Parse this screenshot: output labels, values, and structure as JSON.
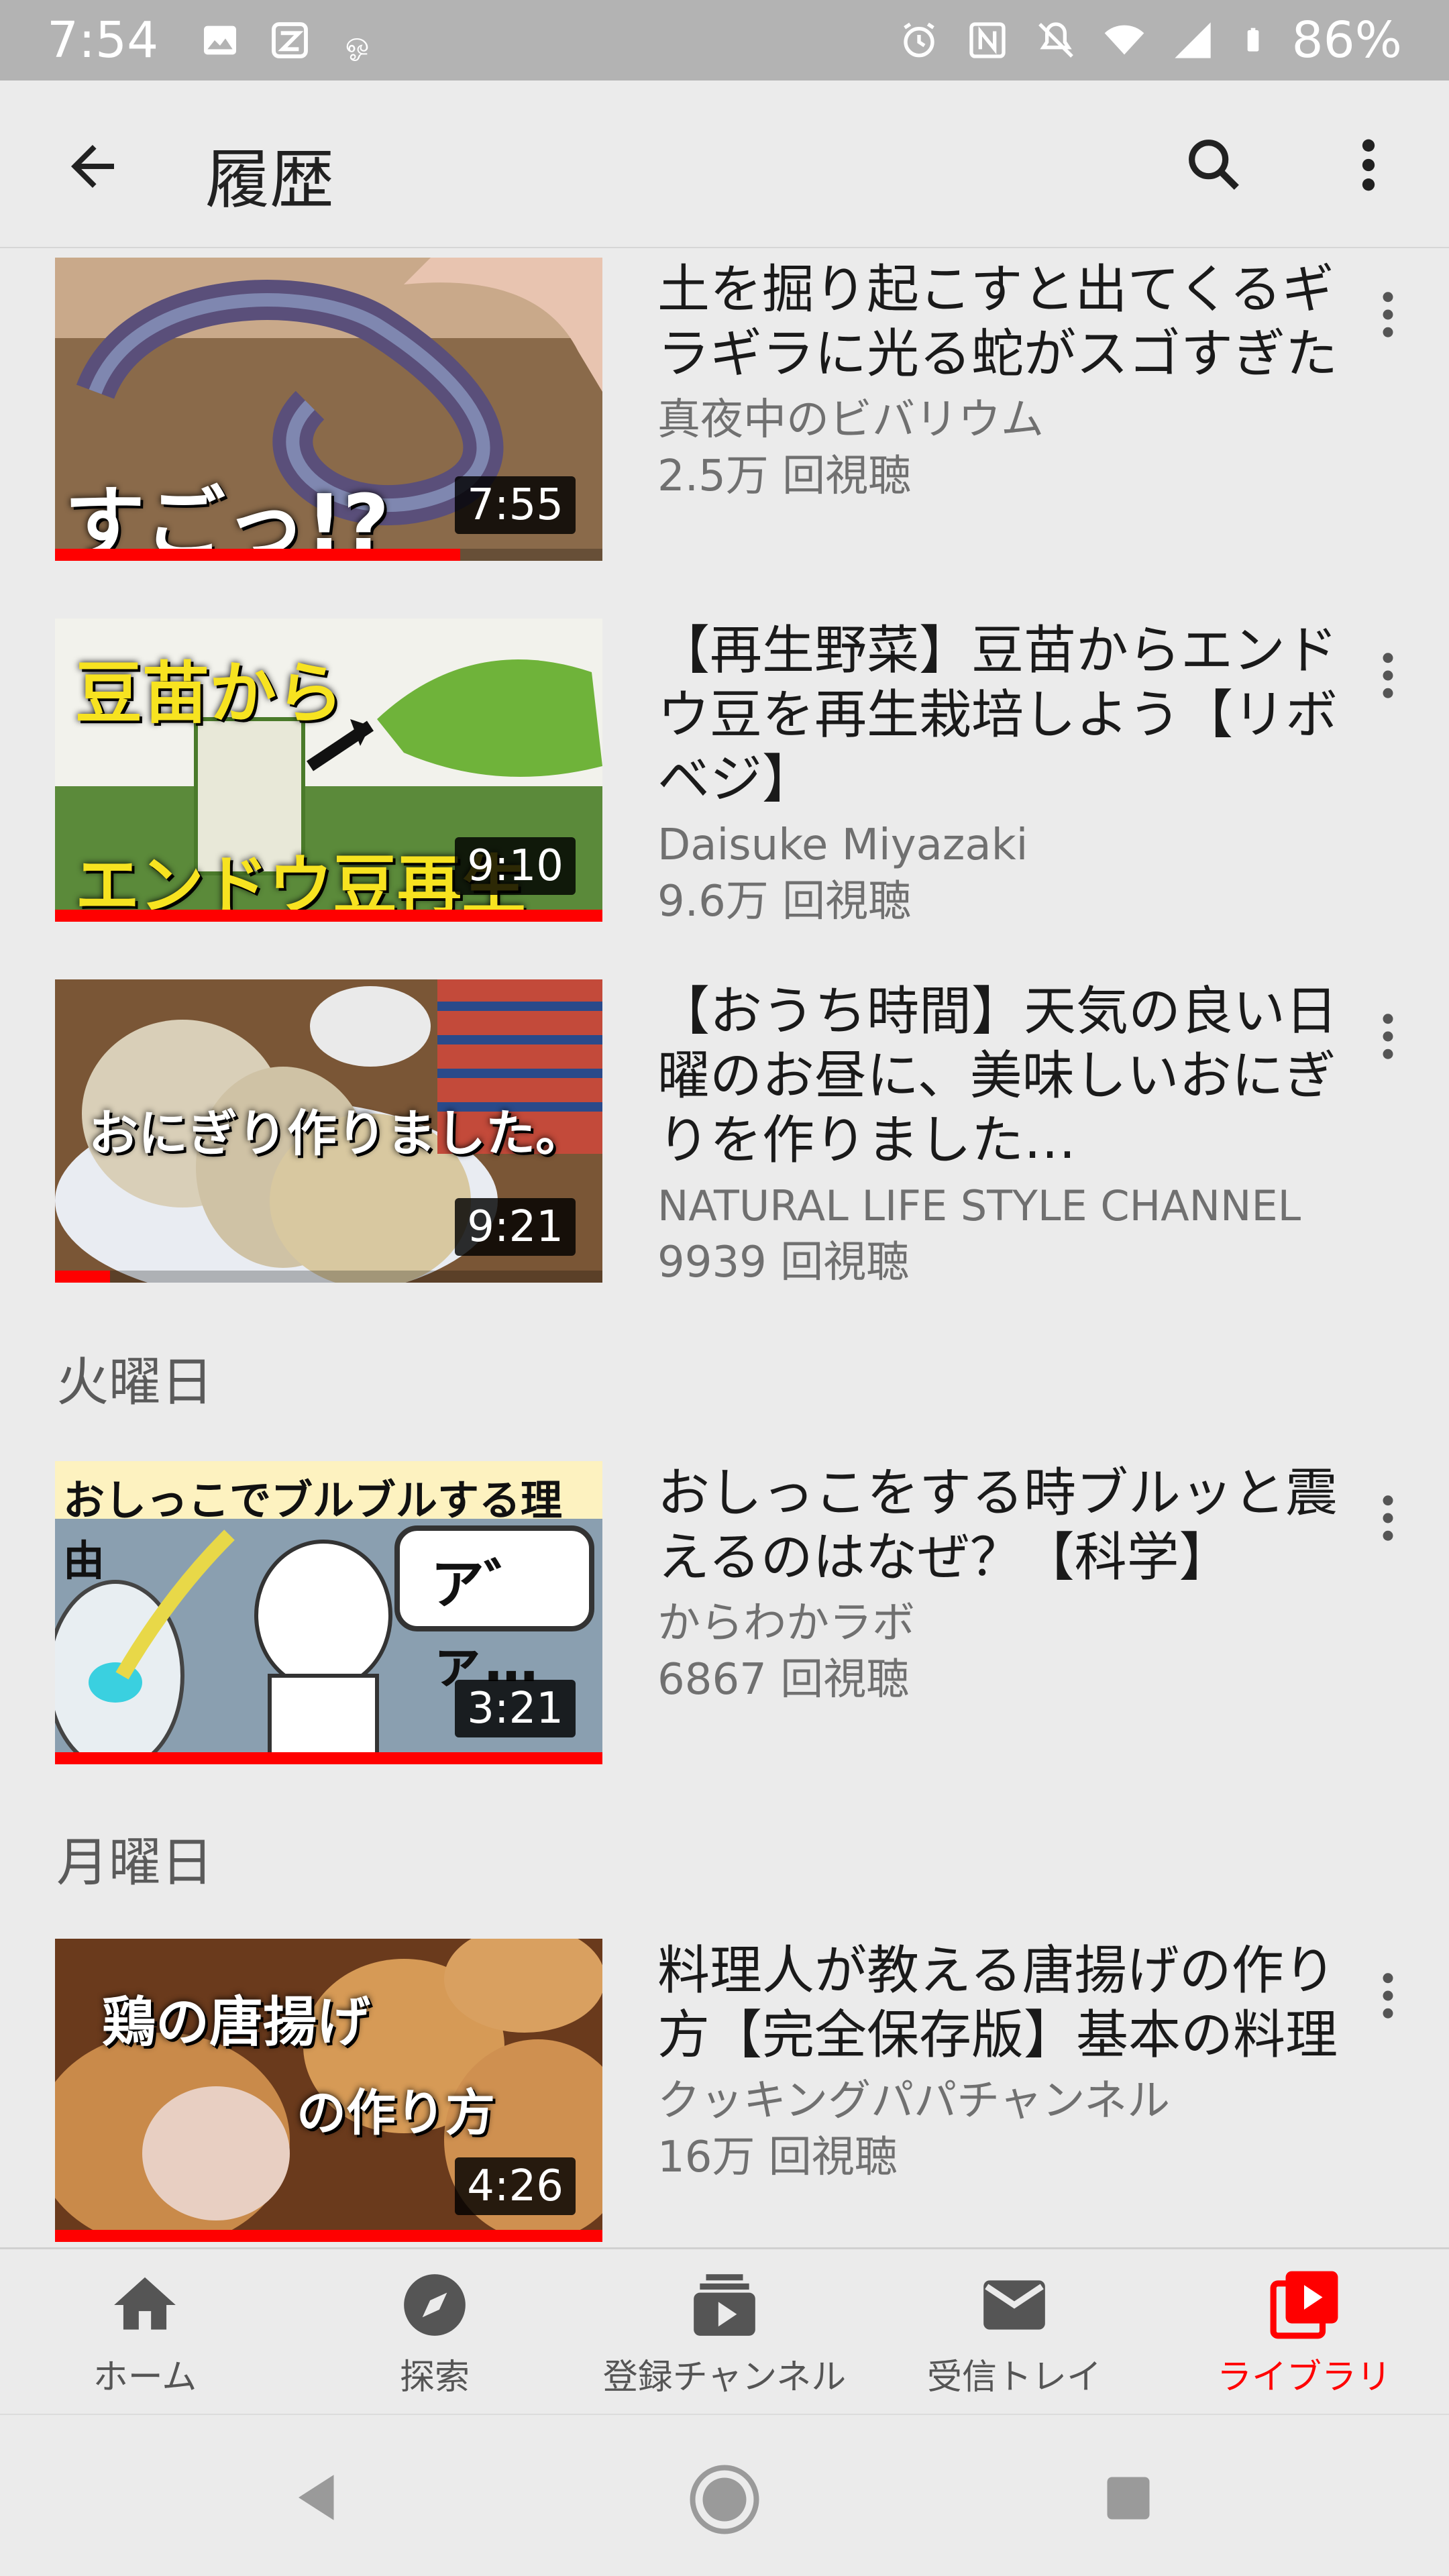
{
  "status_bar": {
    "time": "7:54",
    "battery": "86%",
    "left_icons": [
      "image-icon",
      "app-icon",
      "notification-icon"
    ],
    "right_icons": [
      "alarm-icon",
      "nfc-icon",
      "mute-icon",
      "wifi-icon",
      "signal-icon",
      "battery-icon"
    ]
  },
  "app_bar": {
    "title": "履歴"
  },
  "sections": [
    {
      "label": "火曜日"
    },
    {
      "label": "月曜日"
    }
  ],
  "videos": [
    {
      "title": "土を掘り起こすと出てくるギラギラに光る蛇がスゴすぎた",
      "channel": "真夜中のビバリウム",
      "views": "2.5万 回視聴",
      "duration": "7:55",
      "progress": 0.74,
      "thumb_text": "すごっ!?"
    },
    {
      "title": "【再生野菜】豆苗からエンドウ豆を再生栽培しよう【リボベジ】",
      "channel": "Daisuke Miyazaki",
      "views": "9.6万 回視聴",
      "duration": "9:10",
      "progress": 1.0,
      "thumb_text": "豆苗から",
      "thumb_text2": "エンドウ豆再生"
    },
    {
      "title": "【おうち時間】天気の良い日曜のお昼に、美味しいおにぎりを作りました…",
      "channel": "NATURAL LIFE STYLE CHANNEL",
      "views": "9939 回視聴",
      "duration": "9:21",
      "progress": 0.1,
      "thumb_text": "おにぎり作りました。"
    },
    {
      "title": "おしっこをする時ブルッと震えるのはなぜ？【科学】",
      "channel": "からわかラボ",
      "views": "6867 回視聴",
      "duration": "3:21",
      "progress": 1.0,
      "thumb_text": "おしっこでブルブルする理由",
      "thumb_text2": "ア゛ァ…"
    },
    {
      "title": "料理人が教える唐揚げの作り方【完全保存版】基本の料理",
      "channel": "クッキングパパチャンネル",
      "views": "16万 回視聴",
      "duration": "4:26",
      "progress": 1.0,
      "thumb_text": "鶏の唐揚げ",
      "thumb_text2": "の作り方"
    }
  ],
  "bottom_nav": [
    {
      "label": "ホーム",
      "icon": "home-icon"
    },
    {
      "label": "探索",
      "icon": "explore-icon"
    },
    {
      "label": "登録チャンネル",
      "icon": "subscriptions-icon"
    },
    {
      "label": "受信トレイ",
      "icon": "inbox-icon"
    },
    {
      "label": "ライブラリ",
      "icon": "library-icon",
      "active": true
    }
  ],
  "colors": {
    "accent": "#ff0000",
    "background": "#ebebeb",
    "status_bar": "#b3b3b3"
  }
}
